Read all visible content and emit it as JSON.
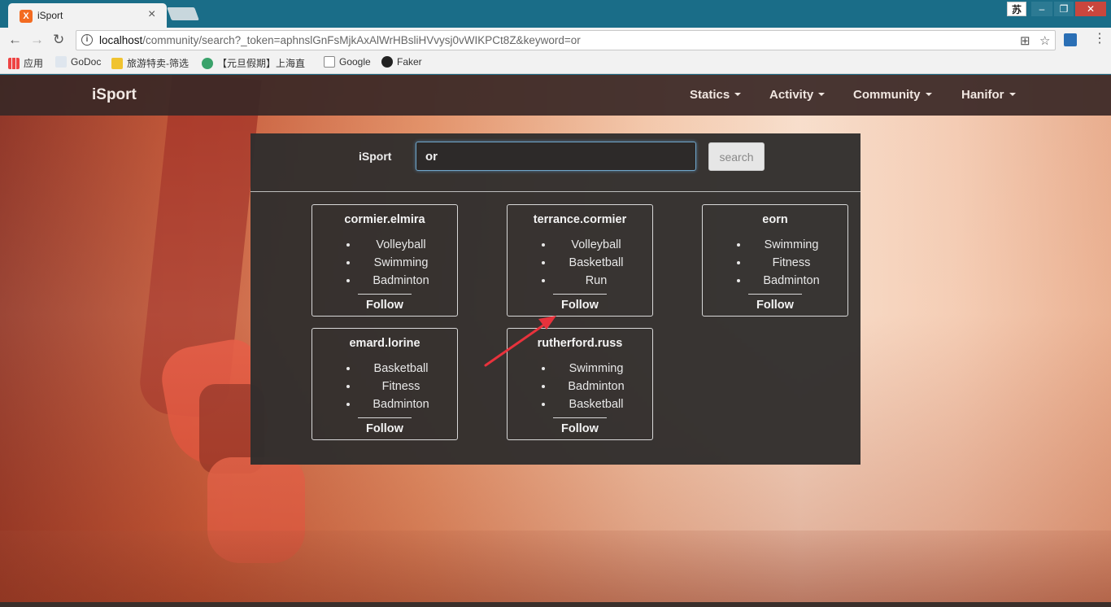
{
  "browser": {
    "tab_title": "iSport",
    "tab_favicon": "X",
    "url_host": "localhost",
    "url_rest": "/community/search?_token=aphnslGnFsMjkAxAlWrHBsliHVvysj0vWIKPCt8Z&keyword=or",
    "ime_label": "苏",
    "bookmarks": [
      "应用",
      "GoDoc",
      "旅游特卖-筛选",
      "【元旦假期】上海直",
      "Google",
      "Faker"
    ]
  },
  "navbar": {
    "brand": "iSport",
    "items": [
      "Statics",
      "Activity",
      "Community",
      "Hanifor"
    ]
  },
  "search": {
    "brand": "iSport",
    "value": "or",
    "button_label": "search"
  },
  "results": [
    {
      "name": "cormier.elmira",
      "sports": [
        "Volleyball",
        "Swimming",
        "Badminton"
      ],
      "follow_label": "Follow"
    },
    {
      "name": "terrance.cormier",
      "sports": [
        "Volleyball",
        "Basketball",
        "Run"
      ],
      "follow_label": "Follow"
    },
    {
      "name": "eorn",
      "sports": [
        "Swimming",
        "Fitness",
        "Badminton"
      ],
      "follow_label": "Follow"
    },
    {
      "name": "emard.lorine",
      "sports": [
        "Basketball",
        "Fitness",
        "Badminton"
      ],
      "follow_label": "Follow"
    },
    {
      "name": "rutherford.russ",
      "sports": [
        "Swimming",
        "Badminton",
        "Basketball"
      ],
      "follow_label": "Follow"
    }
  ],
  "colors": {
    "navbar_bg": "#3a2826",
    "panel_bg": "#302e2d",
    "annotation_arrow": "#e8323c"
  }
}
